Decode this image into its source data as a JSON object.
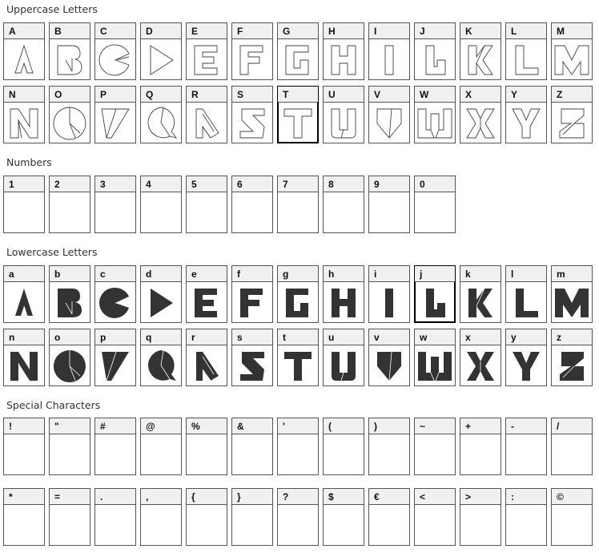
{
  "sections": {
    "uppercase": {
      "title": "Uppercase Letters"
    },
    "numbers": {
      "title": "Numbers"
    },
    "lowercase": {
      "title": "Lowercase Letters"
    },
    "special": {
      "title": "Special Characters"
    }
  },
  "uppercase": [
    "A",
    "B",
    "C",
    "D",
    "E",
    "F",
    "G",
    "H",
    "I",
    "J",
    "K",
    "L",
    "M",
    "N",
    "O",
    "P",
    "Q",
    "R",
    "S",
    "T",
    "U",
    "V",
    "W",
    "X",
    "Y",
    "Z"
  ],
  "numbers": [
    "1",
    "2",
    "3",
    "4",
    "5",
    "6",
    "7",
    "8",
    "9",
    "0"
  ],
  "lowercase": [
    "a",
    "b",
    "c",
    "d",
    "e",
    "f",
    "g",
    "h",
    "i",
    "j",
    "k",
    "l",
    "m",
    "n",
    "o",
    "p",
    "q",
    "r",
    "s",
    "t",
    "u",
    "v",
    "w",
    "x",
    "y",
    "z"
  ],
  "special": [
    "!",
    "\"",
    "#",
    "@",
    "%",
    "&",
    "'",
    "(",
    ")",
    "~",
    "+",
    "-",
    "/",
    "*",
    "=",
    ".",
    ",",
    "{",
    "}",
    "?",
    "$",
    "€",
    "<",
    ">",
    ":",
    "©"
  ]
}
